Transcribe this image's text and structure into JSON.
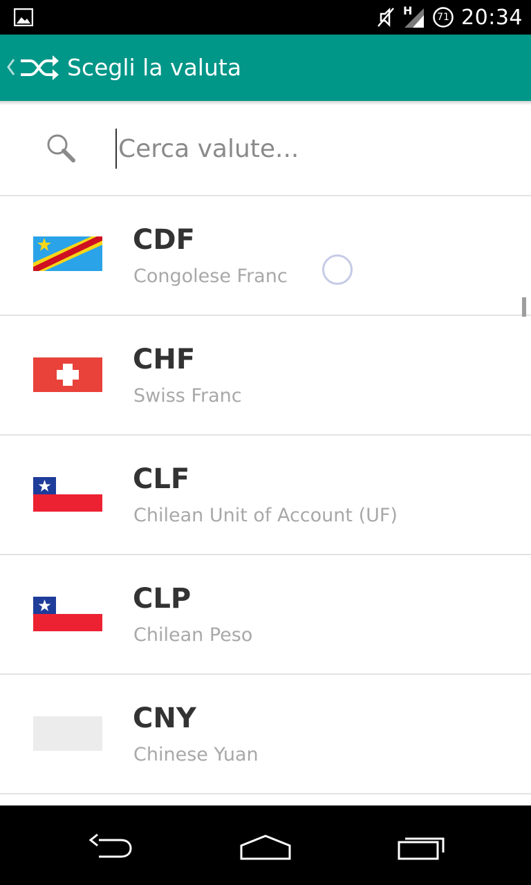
{
  "status_bar": {
    "time": "20:34",
    "network_label": "H",
    "battery_level": "71",
    "icons": [
      "image-notification-icon",
      "mute-icon",
      "signal-icon",
      "battery-icon"
    ]
  },
  "toolbar": {
    "title": "Scegli la valuta",
    "icons": [
      "back-chevron-icon",
      "shuffle-icon"
    ],
    "background": "#009688"
  },
  "search": {
    "placeholder": "Cerca valute...",
    "value": ""
  },
  "currencies": [
    {
      "code": "CDF",
      "name": "Congolese Franc",
      "flag": "flag-congo-icon"
    },
    {
      "code": "CHF",
      "name": "Swiss Franc",
      "flag": "flag-switzerland-icon"
    },
    {
      "code": "CLF",
      "name": "Chilean Unit of Account (UF)",
      "flag": "flag-chile-icon"
    },
    {
      "code": "CLP",
      "name": "Chilean Peso",
      "flag": "flag-chile-icon"
    },
    {
      "code": "CNY",
      "name": "Chinese Yuan",
      "flag": "flag-placeholder-icon"
    }
  ],
  "nav_bar": {
    "icons": [
      "back-icon",
      "home-icon",
      "recents-icon"
    ]
  }
}
